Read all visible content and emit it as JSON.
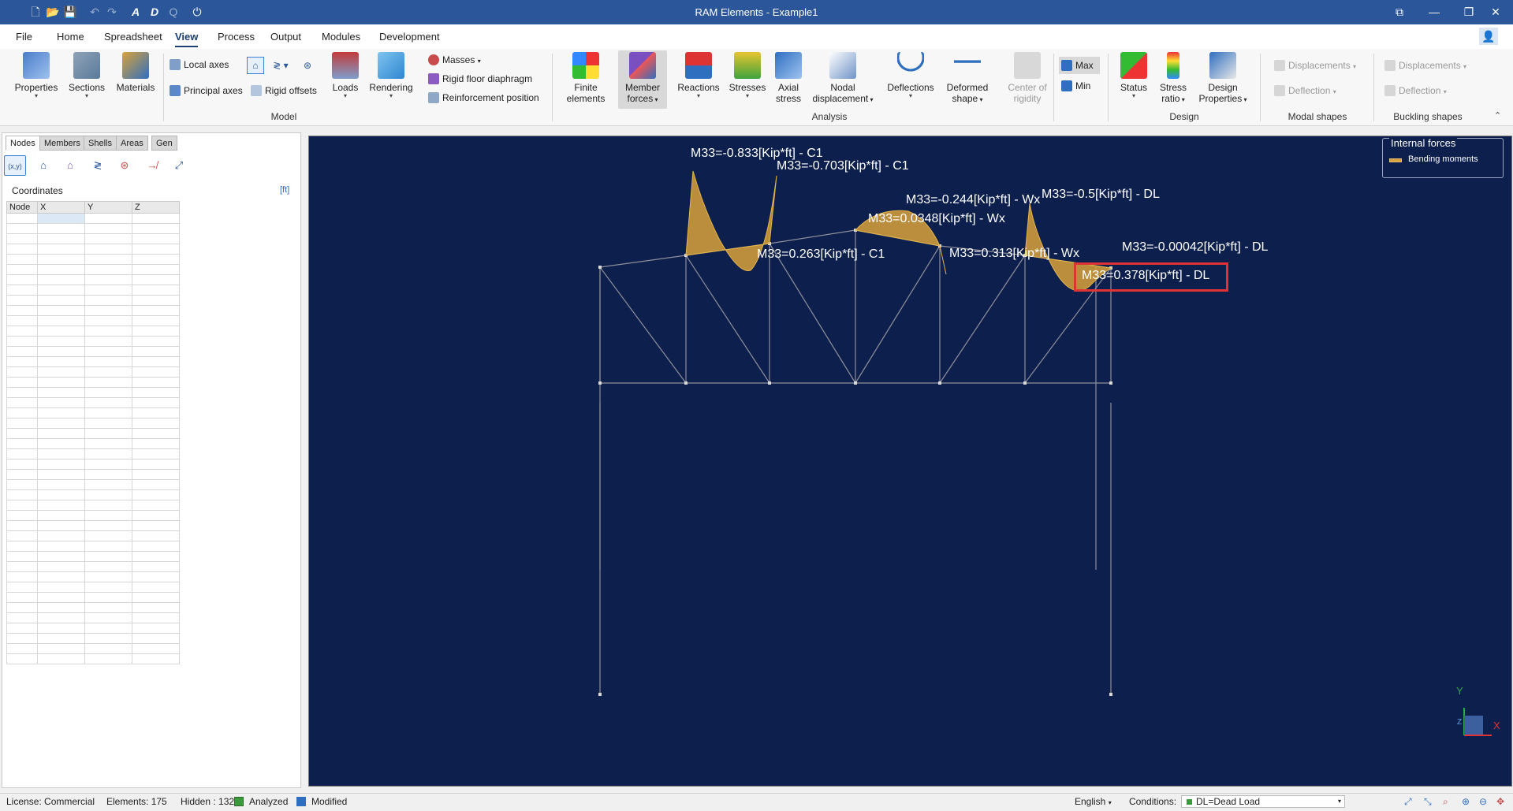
{
  "app": {
    "title": "RAM Elements - Example1"
  },
  "menu": {
    "items": [
      "File",
      "Home",
      "Spreadsheet",
      "View",
      "Process",
      "Output",
      "Modules",
      "Development"
    ],
    "active": "View"
  },
  "ribbon": {
    "model": {
      "label": "Model",
      "properties": "Properties",
      "sections": "Sections",
      "materials": "Materials",
      "local_axes": "Local axes",
      "principal_axes": "Principal axes",
      "rigid_offsets": "Rigid offsets",
      "loads": "Loads",
      "rendering": "Rendering",
      "masses": "Masses",
      "rigid_floor": "Rigid floor diaphragm",
      "reinforcement": "Reinforcement position"
    },
    "analysis": {
      "label": "Analysis",
      "finite_l1": "Finite",
      "finite_l2": "elements",
      "member_l1": "Member",
      "member_l2": "forces",
      "reactions": "Reactions",
      "stresses": "Stresses",
      "axial_l1": "Axial",
      "axial_l2": "stress",
      "nodal_l1": "Nodal",
      "nodal_l2": "displacement",
      "deflections": "Deflections",
      "deformed_l1": "Deformed",
      "deformed_l2": "shape",
      "center_l1": "Center of",
      "center_l2": "rigidity",
      "max": "Max",
      "min": "Min"
    },
    "design": {
      "label": "Design",
      "status": "Status",
      "stress_l1": "Stress",
      "stress_l2": "ratio",
      "design_l1": "Design",
      "design_l2": "Properties"
    },
    "modal": {
      "label": "Modal shapes",
      "displacements": "Displacements",
      "deflection": "Deflection"
    },
    "buckling": {
      "label": "Buckling shapes",
      "displacements": "Displacements",
      "deflection": "Deflection"
    }
  },
  "left_panel": {
    "tabs": [
      "Nodes",
      "Members",
      "Shells",
      "Areas",
      "Gen"
    ],
    "active_tab": "Nodes",
    "tool_xyz": "(x,y)",
    "section_title": "Coordinates",
    "unit": "[ft]",
    "columns": [
      "Node",
      "X",
      "Y",
      "Z"
    ]
  },
  "viewport": {
    "legend_title": "Internal forces",
    "legend_item": "Bending moments",
    "legend_color": "#d9a23a",
    "labels": [
      "M33=-0.833[Kip*ft] - C1",
      "M33=-0.703[Kip*ft] - C1",
      "M33=-0.244[Kip*ft] - Wx",
      "M33=0.0348[Kip*ft] - Wx",
      "M33=-0.5[Kip*ft] - DL",
      "M33=0.263[Kip*ft] - C1",
      "M33=0.313[Kip*ft] - Wx",
      "M33=-0.00042[Kip*ft] - DL",
      "M33=0.378[Kip*ft] - DL"
    ],
    "highlight_color": "#e03434",
    "axis_y": "Y",
    "axis_x": "X",
    "axis_z": "Z"
  },
  "status": {
    "license": "License: Commercial",
    "elements": "Elements: 175",
    "hidden": "Hidden : 132",
    "analyzed": "Analyzed",
    "modified": "Modified",
    "language": "English",
    "conditions_label": "Conditions:",
    "condition": "DL=Dead Load"
  }
}
